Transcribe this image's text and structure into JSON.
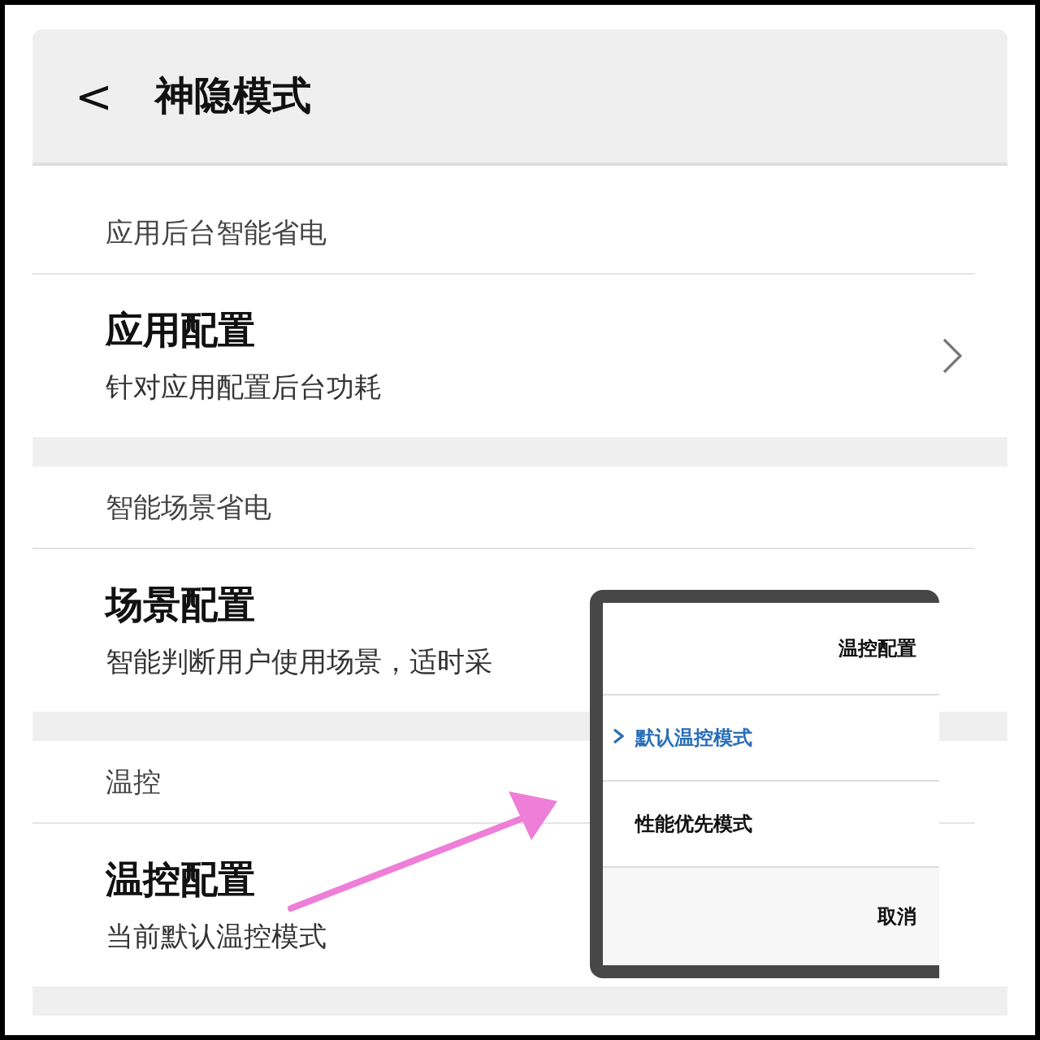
{
  "header": {
    "back": "<",
    "title": "神隐模式"
  },
  "sections": [
    {
      "heading": "应用后台智能省电",
      "items": [
        {
          "title": "应用配置",
          "subtitle": "针对应用配置后台功耗",
          "chevron": true
        }
      ]
    },
    {
      "heading": "智能场景省电",
      "items": [
        {
          "title": "场景配置",
          "subtitle": "智能判断用户使用场景，适时采",
          "chevron": false
        }
      ]
    },
    {
      "heading": "温控",
      "items": [
        {
          "title": "温控配置",
          "subtitle": "当前默认温控模式",
          "chevron": false
        }
      ]
    }
  ],
  "dialog": {
    "title": "温控配置",
    "options": [
      {
        "label": "默认温控模式",
        "selected": true
      },
      {
        "label": "性能优先模式",
        "selected": false
      }
    ],
    "cancel": "取消"
  }
}
